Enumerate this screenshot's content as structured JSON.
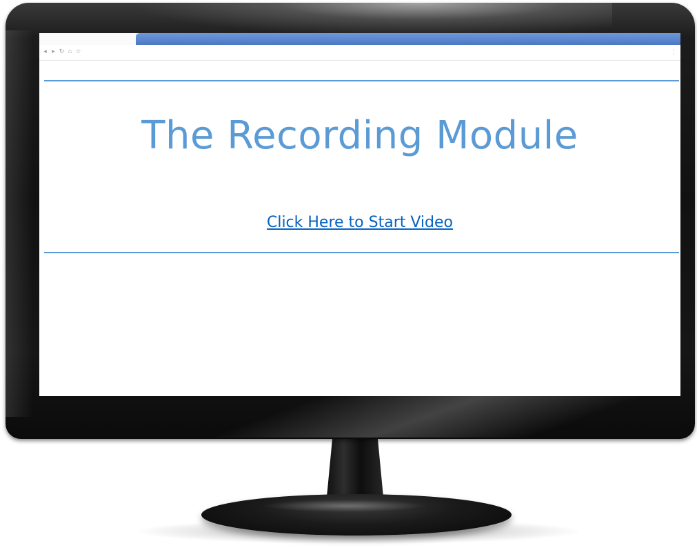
{
  "page": {
    "title": "The Recording Module",
    "link_label": "Click Here to Start Video"
  },
  "browser": {
    "toolbar_icons": [
      "back-icon",
      "forward-icon",
      "reload-icon",
      "home-icon",
      "bookmark-icon"
    ],
    "menu_icon": "menu-icon"
  },
  "colors": {
    "title": "#5b9bd5",
    "rule": "#5b9bd5",
    "link": "#0563c1",
    "tab_accent": "#4a78c4",
    "bezel": "#111111"
  }
}
